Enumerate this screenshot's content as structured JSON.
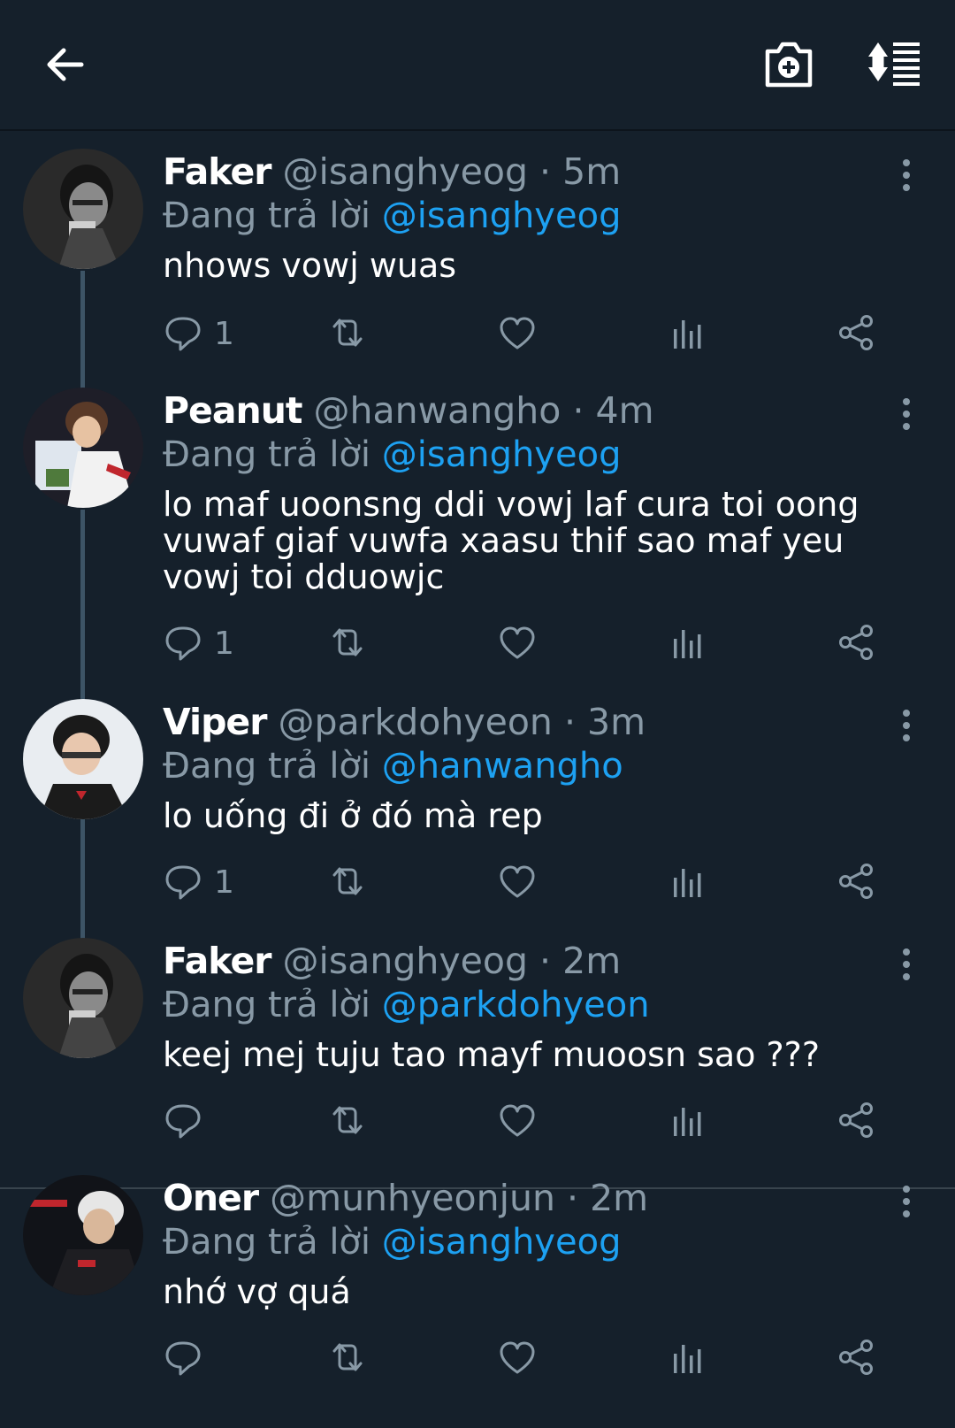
{
  "colors": {
    "background": "#15202b",
    "text_primary": "#ffffff",
    "text_secondary": "#8899a6",
    "accent": "#1da1f2",
    "thread_line": "#3d5466"
  },
  "header": {
    "back_icon": "arrow-left-icon",
    "camera_icon": "camera-plus-icon",
    "sort_icon": "sort-list-icon"
  },
  "tweets": [
    {
      "name": "Faker",
      "handle": "@isanghyeog",
      "time": "· 5m",
      "replying_prefix": "Đang trả lời",
      "replying_to": "@isanghyeog",
      "text": "nhows vowj wuas",
      "reply_count": "1",
      "avatar": "faker-avatar"
    },
    {
      "name": "Peanut",
      "handle": "@hanwangho",
      "time": "· 4m",
      "replying_prefix": "Đang trả lời",
      "replying_to": "@isanghyeog",
      "text": "lo maf uoonsng ddi vowj laf cura toi oong vuwaf giaf vuwfa xaasu thif sao maf yeu vowj toi dduowjc",
      "reply_count": "1",
      "avatar": "peanut-avatar"
    },
    {
      "name": "Viper",
      "handle": "@parkdohyeon",
      "time": "· 3m",
      "replying_prefix": "Đang trả lời",
      "replying_to": "@hanwangho",
      "text": "lo uống đi ở đó mà rep",
      "reply_count": "1",
      "avatar": "viper-avatar"
    },
    {
      "name": "Faker",
      "handle": "@isanghyeog",
      "time": "· 2m",
      "replying_prefix": "Đang trả lời",
      "replying_to": "@parkdohyeon",
      "text": "keej mej tuju tao mayf muoosn sao ???",
      "reply_count": "",
      "avatar": "faker-avatar"
    },
    {
      "name": "Oner",
      "handle": "@munhyeonjun",
      "time": "· 2m",
      "replying_prefix": "Đang trả lời",
      "replying_to": "@isanghyeog",
      "text": "nhớ vợ quá",
      "reply_count": "",
      "avatar": "oner-avatar"
    }
  ]
}
